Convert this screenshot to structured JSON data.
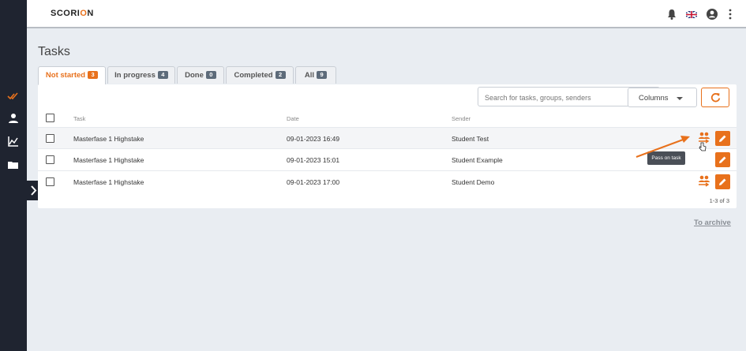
{
  "app": {
    "logo_pre": "SCORI",
    "logo_o": "O",
    "logo_post": "N"
  },
  "sidebar": {
    "items": [
      {
        "icon": "double-check-icon",
        "active": true
      },
      {
        "icon": "user-icon"
      },
      {
        "icon": "chart-icon"
      },
      {
        "icon": "folder-icon"
      }
    ],
    "expand_icon": "chevron-right-icon"
  },
  "header": {
    "icons": [
      "bell-icon",
      "uk-flag-icon",
      "account-icon",
      "more-vertical-icon"
    ]
  },
  "page": {
    "title": "Tasks"
  },
  "tabs": [
    {
      "label": "Not started",
      "count": "3",
      "active": true
    },
    {
      "label": "In progress",
      "count": "4"
    },
    {
      "label": "Done",
      "count": "0"
    },
    {
      "label": "Completed",
      "count": "2"
    },
    {
      "label": "All",
      "count": "9"
    }
  ],
  "toolbar": {
    "search_placeholder": "Search for tasks, groups, senders",
    "columns_label": "Columns"
  },
  "table": {
    "headers": {
      "task": "Task",
      "date": "Date",
      "sender": "Sender"
    },
    "rows": [
      {
        "task": "Masterfase 1 Highstake",
        "date": "09-01-2023 16:49",
        "sender": "Student Test"
      },
      {
        "task": "Masterfase 1 Highstake",
        "date": "09-01-2023 15:01",
        "sender": "Student Example"
      },
      {
        "task": "Masterfase 1 Highstake",
        "date": "09-01-2023 17:00",
        "sender": "Student Demo"
      }
    ],
    "pagination": "1-3 of 3",
    "tooltip": "Pass on task"
  },
  "footer": {
    "archive_label": "To archive"
  },
  "colors": {
    "accent": "#e8711c",
    "sidebar_bg": "#1f2430",
    "page_bg": "#e9edf2"
  }
}
